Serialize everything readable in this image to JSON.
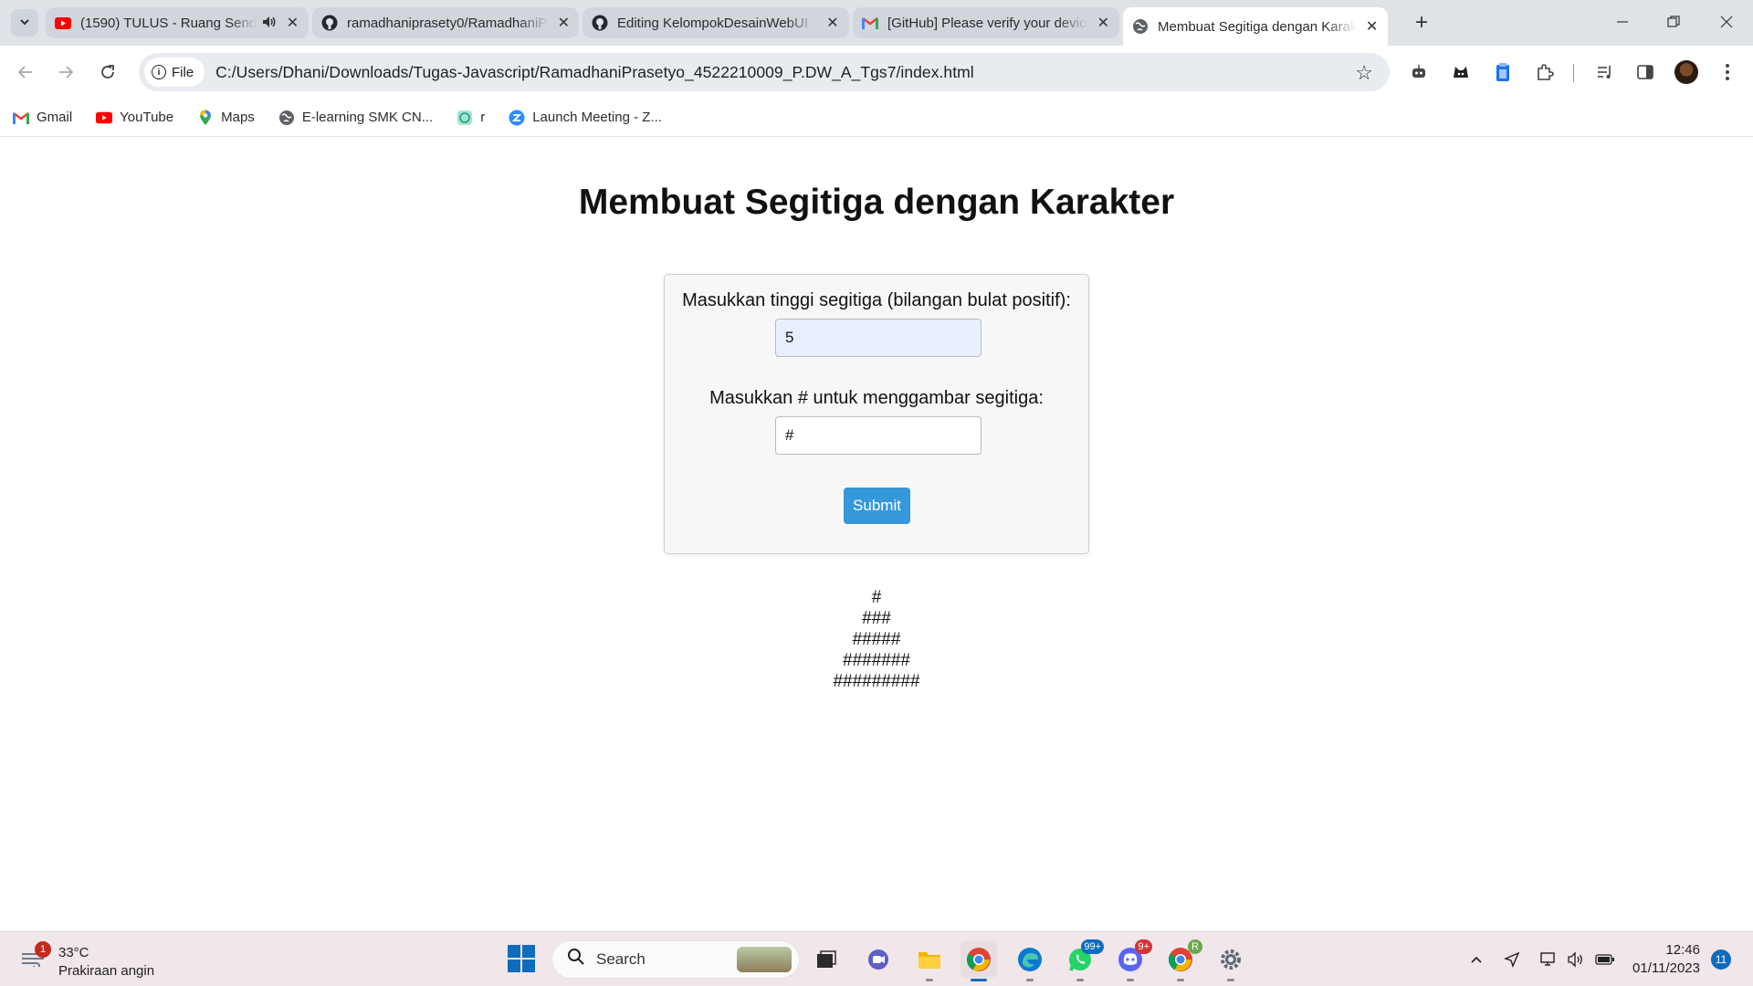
{
  "browser": {
    "tabs": [
      {
        "title": "(1590) TULUS - Ruang Sendiri",
        "favicon": "youtube-icon",
        "audio": true
      },
      {
        "title": "ramadhaniprasety0/RamadhaniPrasetyo",
        "favicon": "github-icon",
        "audio": false
      },
      {
        "title": "Editing KelompokDesainWebUI",
        "favicon": "github-icon",
        "audio": false
      },
      {
        "title": "[GitHub] Please verify your device",
        "favicon": "gmail-icon",
        "audio": false
      },
      {
        "title": "Membuat Segitiga dengan Karakter",
        "favicon": "globe-icon",
        "audio": false,
        "active": true
      }
    ],
    "chip_label": "File",
    "url": "C:/Users/Dhani/Downloads/Tugas-Javascript/RamadhaniPrasetyo_4522210009_P.DW_A_Tgs7/index.html",
    "bookmarks": [
      {
        "label": "Gmail",
        "icon": "gmail-icon"
      },
      {
        "label": "YouTube",
        "icon": "youtube-icon"
      },
      {
        "label": "Maps",
        "icon": "maps-icon"
      },
      {
        "label": "E-learning SMK CN...",
        "icon": "globe-icon"
      },
      {
        "label": "r",
        "icon": "chatgpt-icon"
      },
      {
        "label": "Launch Meeting - Z...",
        "icon": "zoom-icon"
      }
    ]
  },
  "page": {
    "title": "Membuat Segitiga dengan Karakter",
    "height_label": "Masukkan tinggi segitiga (bilangan bulat positif):",
    "height_value": "5",
    "char_label": "Masukkan # untuk menggambar segitiga:",
    "char_value": "#",
    "submit_label": "Submit",
    "triangle_rows": [
      "#",
      "###",
      "#####",
      "#######",
      "#########"
    ],
    "submit_color": "#3498db"
  },
  "taskbar": {
    "weather_badge": "1",
    "weather_temp": "33°C",
    "weather_desc": "Prakiraan angin",
    "search_label": "Search",
    "whatsapp_badge": "99+",
    "discord_badge": "9+",
    "chrome_profile_badge": "R",
    "time": "12:46",
    "date": "01/11/2023",
    "notification_count": "11"
  }
}
